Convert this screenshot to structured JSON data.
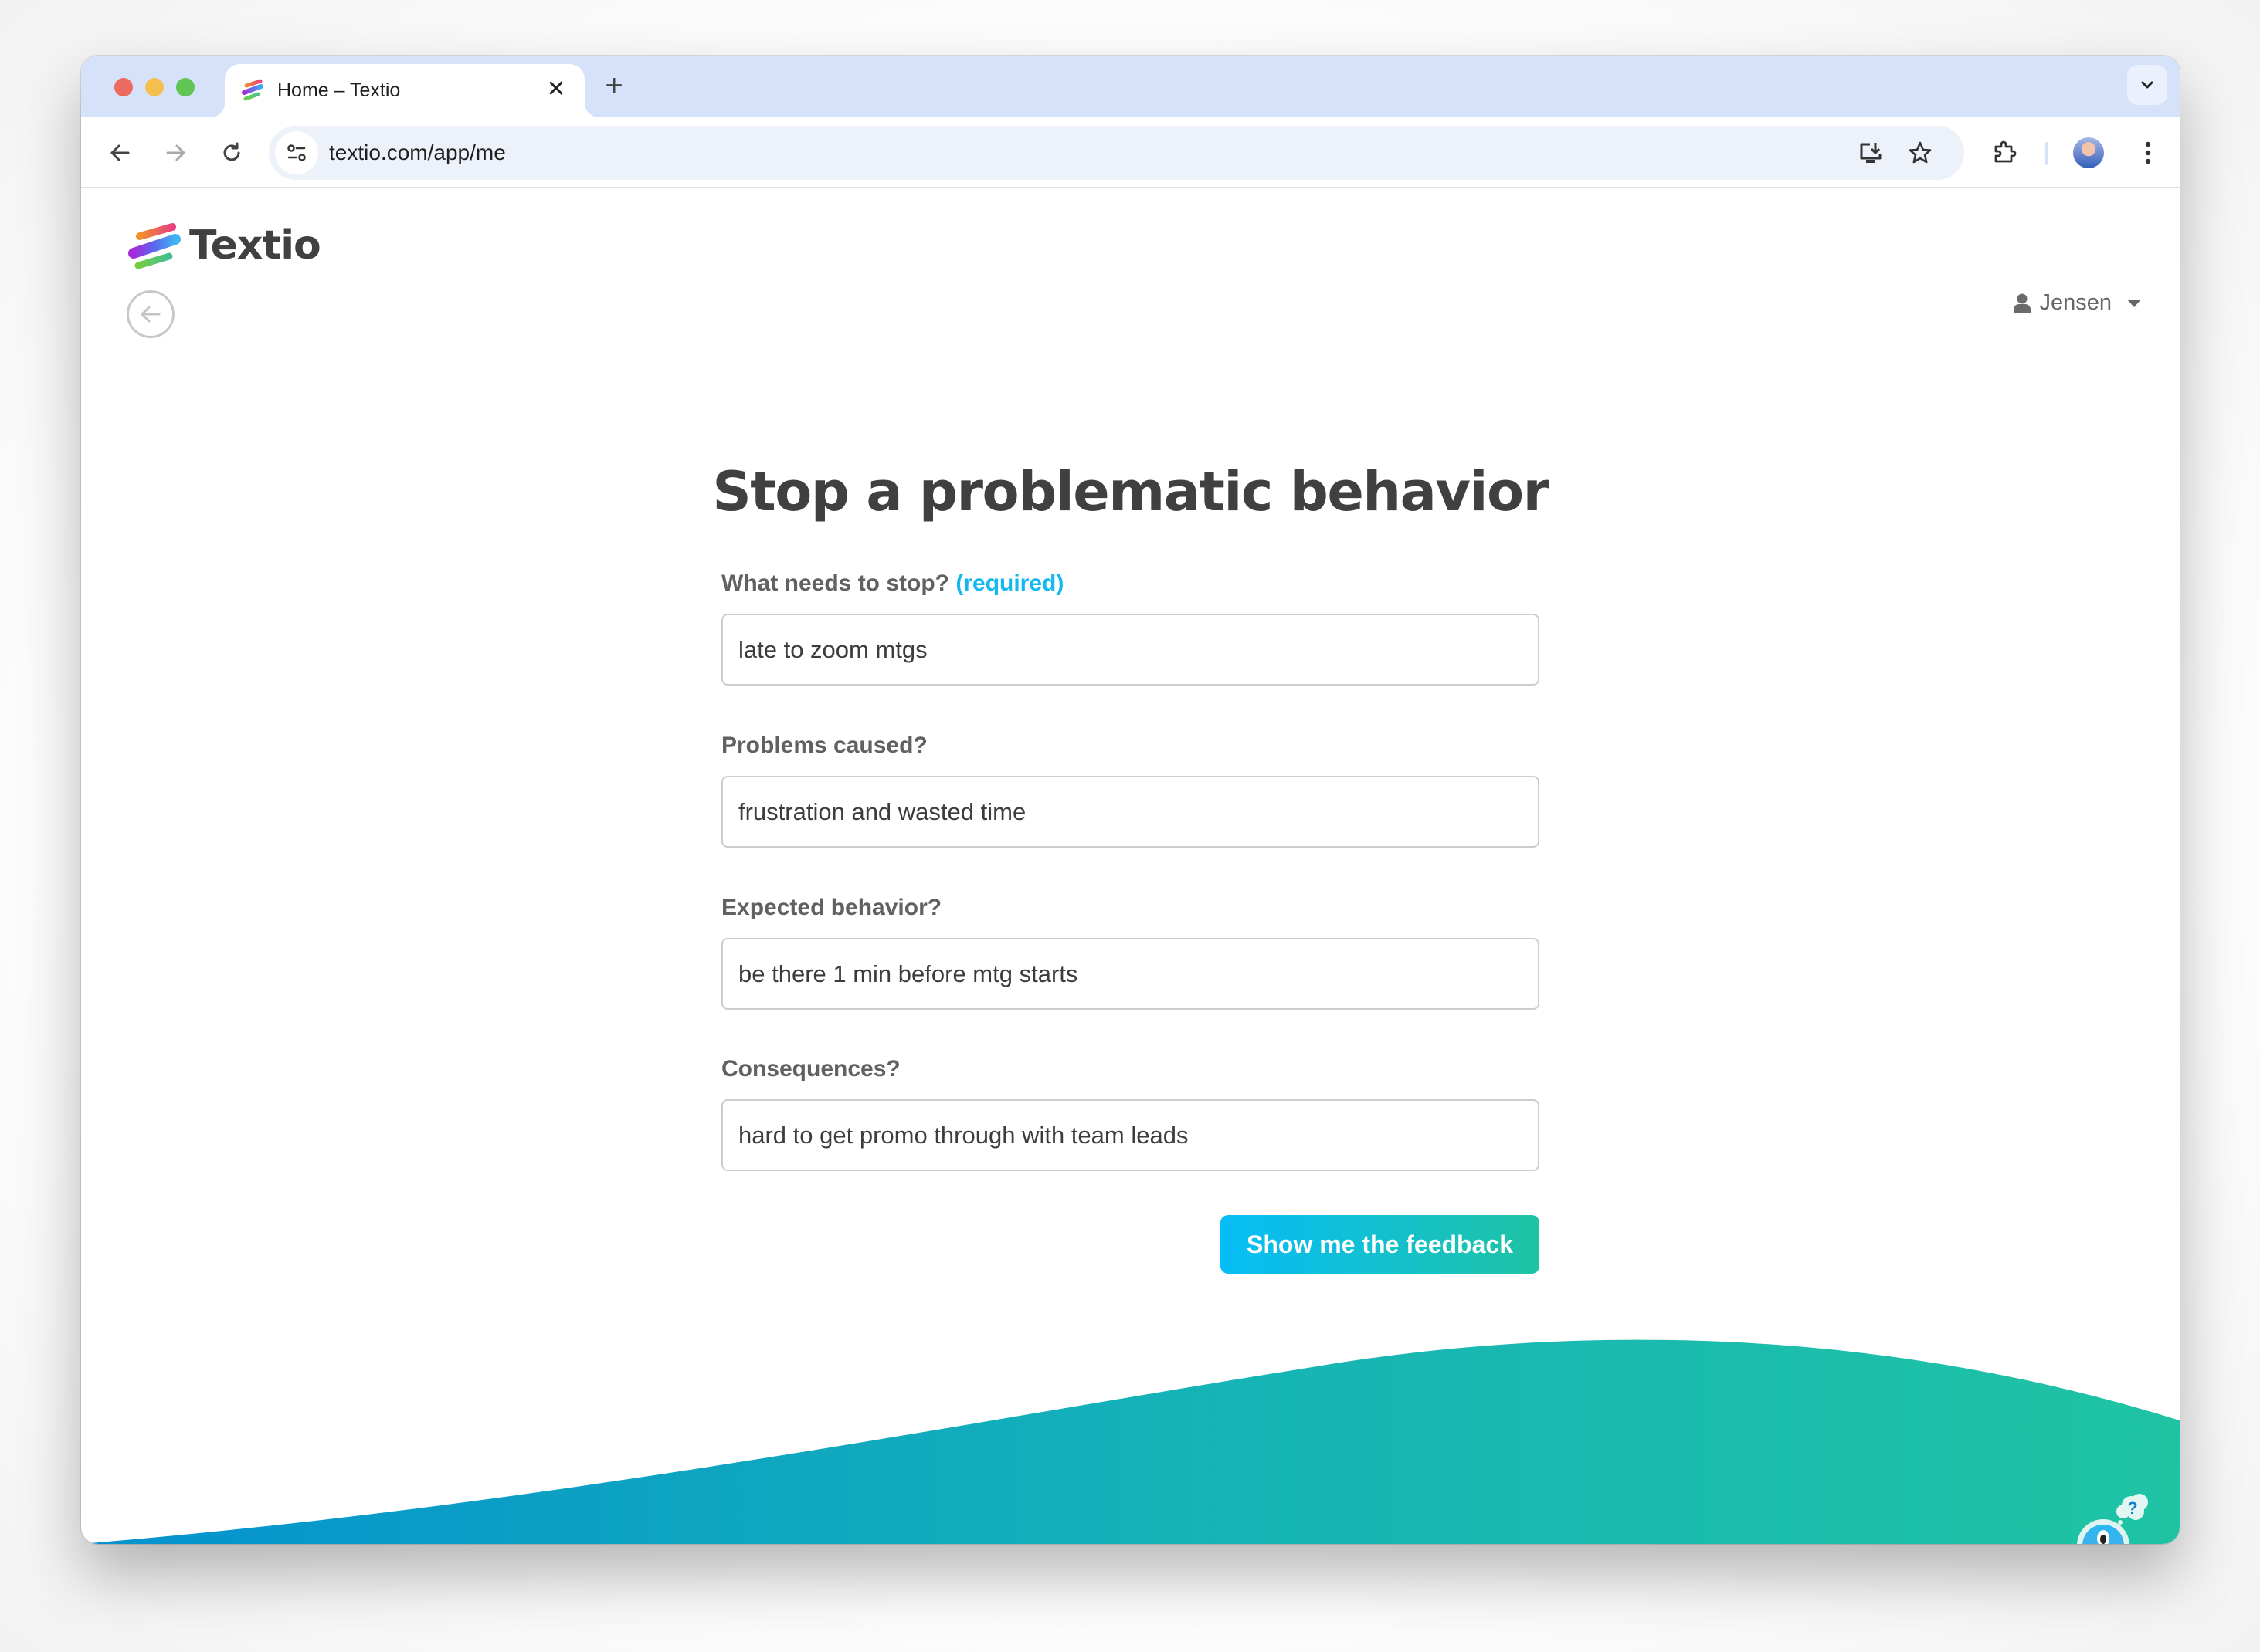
{
  "browser": {
    "tab_title": "Home – Textio",
    "tab_close_glyph": "✕",
    "new_tab_glyph": "+",
    "url": "textio.com/app/me",
    "icons": [
      "back-icon",
      "forward-icon",
      "reload-icon",
      "site-info-icon",
      "install-app-icon",
      "bookmark-star-icon",
      "extensions-icon",
      "profile-avatar",
      "more-menu-icon",
      "tab-search-icon"
    ]
  },
  "app": {
    "logo_text": "Textio",
    "user_name": "Jensen",
    "back_label": "Back"
  },
  "form": {
    "title": "Stop a problematic behavior",
    "fields": [
      {
        "label": "What needs to stop?",
        "required_tag": "(required)",
        "value": "late to zoom mtgs"
      },
      {
        "label": "Problems caused?",
        "required_tag": "",
        "value": "frustration and wasted time"
      },
      {
        "label": "Expected behavior?",
        "required_tag": "",
        "value": "be there 1 min before mtg starts"
      },
      {
        "label": "Consequences?",
        "required_tag": "",
        "value": "hard to get promo through with team leads"
      }
    ],
    "submit_label": "Show me the feedback"
  },
  "help": {
    "bubble_glyph": "?"
  },
  "colors": {
    "accent": "#14b8f0",
    "button_gradient_start": "#07bdf7",
    "button_gradient_end": "#1fc3a3",
    "wave_start": "#0492cf",
    "wave_end": "#1fc3a3",
    "text_dark": "#404040",
    "label": "#616161"
  }
}
